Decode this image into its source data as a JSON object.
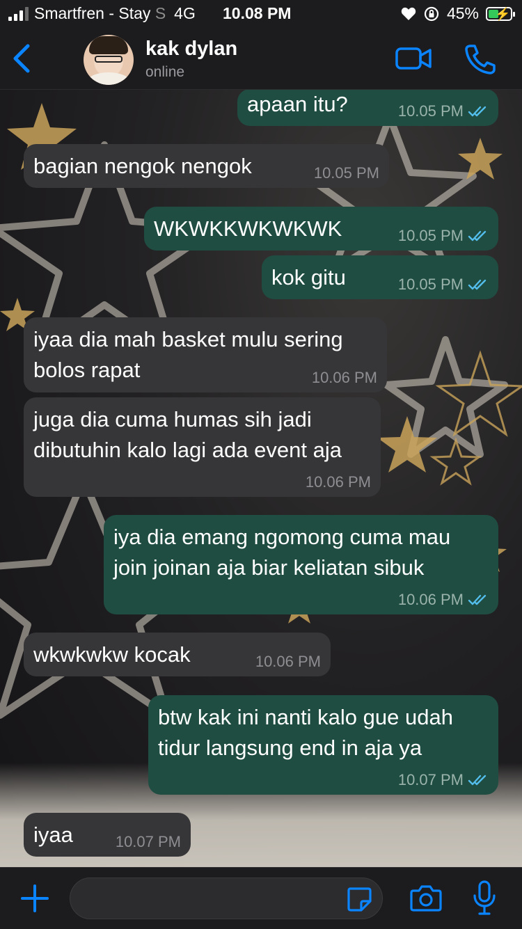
{
  "status_bar": {
    "carrier": "Smartfren - Stay",
    "carrier_fade": "S",
    "network": "4G",
    "time": "10.08 PM",
    "battery": "45%",
    "battery_level": 0.45,
    "icons": [
      "signal-icon",
      "heart-icon",
      "rotation-lock-icon",
      "battery-icon"
    ]
  },
  "header": {
    "contact_name": "kak dylan",
    "presence": "online",
    "icons": [
      "back-chevron-icon",
      "video-camera-icon",
      "phone-icon"
    ]
  },
  "messages": [
    {
      "direction": "out",
      "lines": [
        "apaan itu?"
      ],
      "time": "10.05 PM",
      "read": true
    },
    {
      "direction": "in",
      "lines": [
        "bagian nengok nengok"
      ],
      "time": "10.05 PM"
    },
    {
      "direction": "out",
      "lines": [
        "WKWKKWKWKWK"
      ],
      "time": "10.05 PM",
      "read": true
    },
    {
      "direction": "out",
      "lines": [
        "kok gitu"
      ],
      "time": "10.05 PM",
      "read": true
    },
    {
      "direction": "in",
      "lines": [
        "iyaa dia mah basket mulu sering",
        "bolos rapat"
      ],
      "time": "10.06 PM"
    },
    {
      "direction": "in",
      "lines": [
        "juga dia cuma humas sih jadi",
        "dibutuhin kalo lagi ada event aja"
      ],
      "time": "10.06 PM"
    },
    {
      "direction": "out",
      "lines": [
        "iya dia emang ngomong cuma mau",
        "join joinan aja biar keliatan sibuk"
      ],
      "time": "10.06 PM",
      "read": true
    },
    {
      "direction": "in",
      "lines": [
        "wkwkwkw kocak"
      ],
      "time": "10.06 PM"
    },
    {
      "direction": "out",
      "lines": [
        "btw kak ini nanti kalo gue udah",
        "tidur langsung end in aja ya"
      ],
      "time": "10.07 PM",
      "read": true
    },
    {
      "direction": "in",
      "lines": [
        "iyaa"
      ],
      "time": "10.07 PM"
    }
  ],
  "composer": {
    "input_value": "",
    "icons": [
      "plus-icon",
      "sticker-icon",
      "camera-icon",
      "microphone-icon"
    ]
  },
  "colors": {
    "incoming_bubble": "#363638",
    "outgoing_bubble": "#1f4d42",
    "accent": "#0a84ff",
    "read_tick": "#53bdeb"
  }
}
